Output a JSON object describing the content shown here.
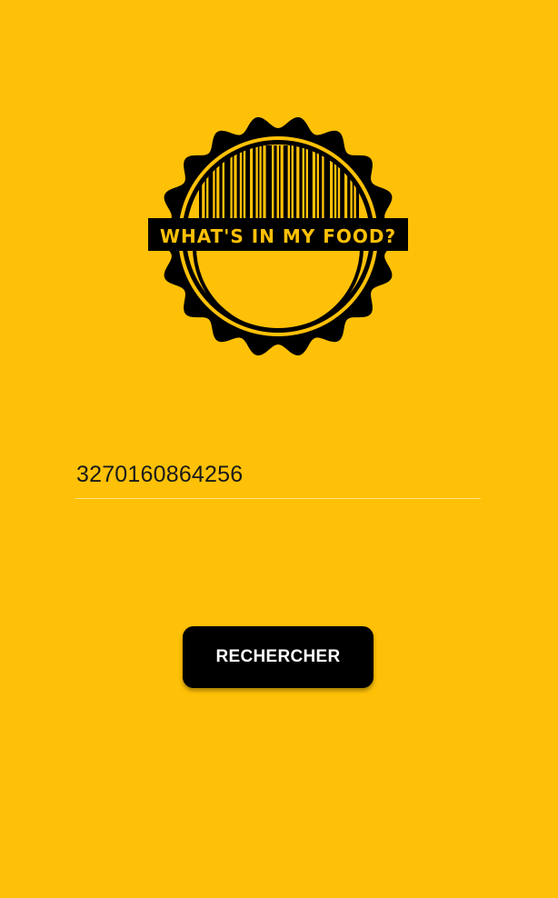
{
  "app": {
    "logo_text": "WHAT'S IN MY FOOD?"
  },
  "search": {
    "barcode_value": "3270160864256",
    "button_label": "RECHERCHER"
  },
  "colors": {
    "background": "#FFC107",
    "button": "#000000",
    "button_text": "#FFFFFF",
    "input_underline": "#FFE28A"
  }
}
